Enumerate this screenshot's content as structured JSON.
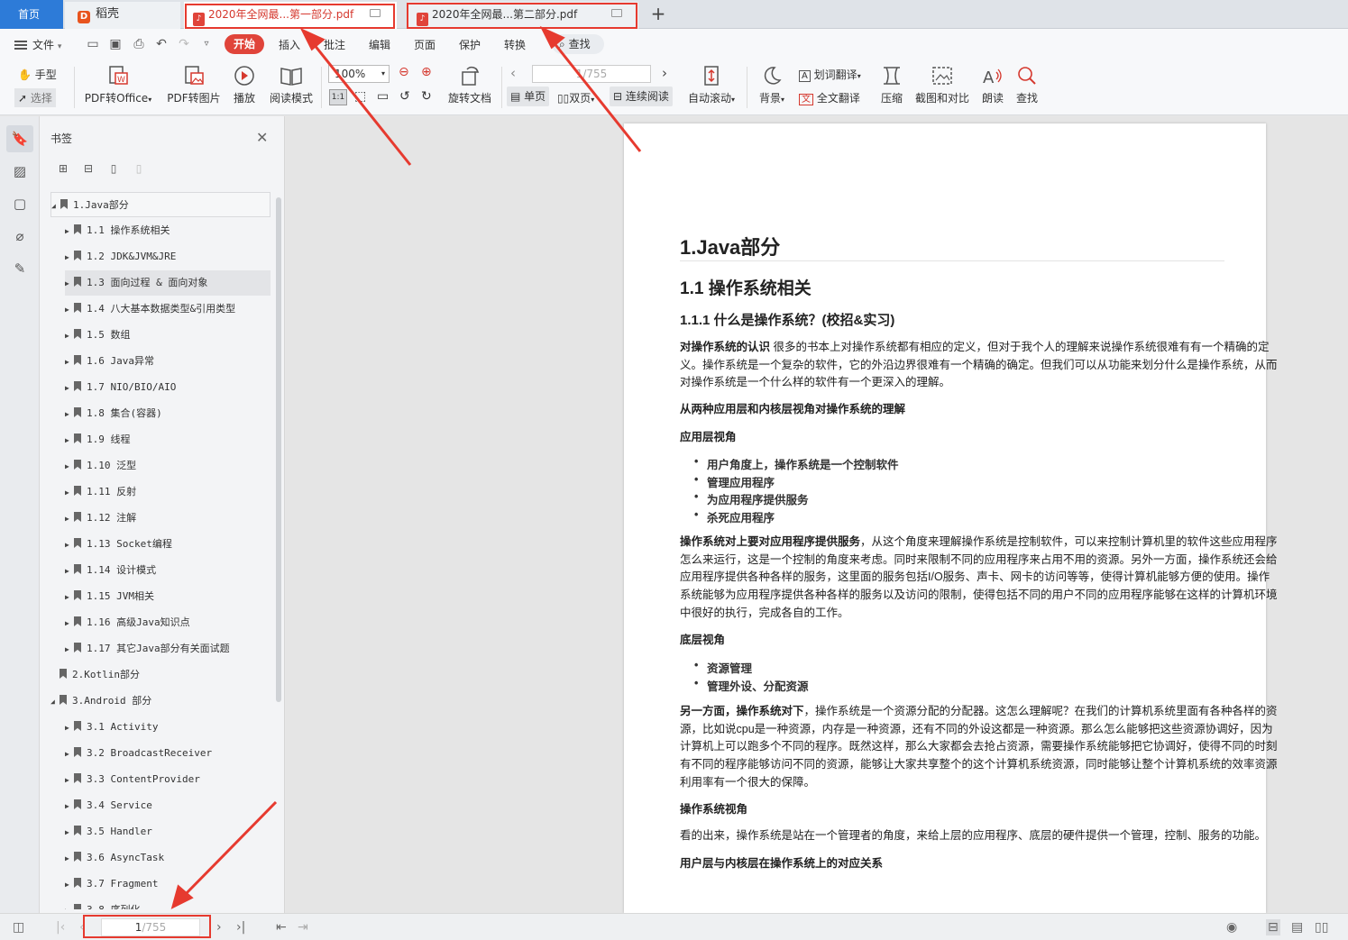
{
  "tabbar": {
    "home": "首页",
    "daoke": "稻壳",
    "doc_tabs": [
      {
        "title": "2020年全网最...第一部分.pdf"
      },
      {
        "title": "2020年全网最...第二部分.pdf"
      }
    ]
  },
  "menubar": {
    "file": "文件",
    "tabs": [
      "开始",
      "插入",
      "批注",
      "编辑",
      "页面",
      "保护",
      "转换"
    ],
    "search": "查找"
  },
  "ribbon": {
    "hand": "手型",
    "select": "选择",
    "pdf_to_office": "PDF转Office",
    "pdf_to_image": "PDF转图片",
    "play": "播放",
    "reading_mode": "阅读模式",
    "zoom": "100%",
    "rotate": "旋转文档",
    "page_input": "1/755",
    "single_page": "单页",
    "double_page": "双页",
    "continuous": "连续阅读",
    "auto_scroll": "自动滚动",
    "background": "背景",
    "word_translate": "划词翻译",
    "full_translate": "全文翻译",
    "compress": "压缩",
    "screenshot_compare": "截图和对比",
    "read_aloud": "朗读",
    "find": "查找"
  },
  "bookmarks": {
    "title": "书签",
    "items": [
      {
        "label": "1.Java部分",
        "level": 0,
        "expanded": true
      },
      {
        "label": "1.1 操作系统相关",
        "level": 1
      },
      {
        "label": "1.2 JDK&JVM&JRE",
        "level": 1
      },
      {
        "label": "1.3 面向过程 & 面向对象",
        "level": 1
      },
      {
        "label": "1.4 八大基本数据类型&引用类型",
        "level": 1
      },
      {
        "label": "1.5 数组",
        "level": 1
      },
      {
        "label": "1.6 Java异常",
        "level": 1
      },
      {
        "label": "1.7 NIO/BIO/AIO",
        "level": 1
      },
      {
        "label": "1.8 集合(容器)",
        "level": 1
      },
      {
        "label": "1.9 线程",
        "level": 1
      },
      {
        "label": "1.10 泛型",
        "level": 1
      },
      {
        "label": "1.11 反射",
        "level": 1
      },
      {
        "label": "1.12 注解",
        "level": 1
      },
      {
        "label": "1.13 Socket编程",
        "level": 1
      },
      {
        "label": "1.14 设计模式",
        "level": 1
      },
      {
        "label": "1.15 JVM相关",
        "level": 1
      },
      {
        "label": "1.16 高级Java知识点",
        "level": 1
      },
      {
        "label": "1.17 其它Java部分有关面试题",
        "level": 1
      },
      {
        "label": "2.Kotlin部分",
        "level": 0,
        "expanded": false
      },
      {
        "label": "3.Android 部分",
        "level": 0,
        "expanded": true
      },
      {
        "label": "3.1 Activity",
        "level": 1
      },
      {
        "label": "3.2 BroadcastReceiver",
        "level": 1
      },
      {
        "label": "3.3 ContentProvider",
        "level": 1
      },
      {
        "label": "3.4 Service",
        "level": 1
      },
      {
        "label": "3.5 Handler",
        "level": 1
      },
      {
        "label": "3.6 AsyncTask",
        "level": 1
      },
      {
        "label": "3.7 Fragment",
        "level": 1
      },
      {
        "label": "3.8 序列化",
        "level": 1
      }
    ]
  },
  "document": {
    "h1": "1.Java部分",
    "h2": "1.1 操作系统相关",
    "h3": "1.1.1 什么是操作系统？(校招&实习)",
    "p1_bold": "对操作系统的认识",
    "p1_text": " 很多的书本上对操作系统都有相应的定义，但对于我个人的理解来说操作系统很难有有一个精确的定义。操作系统是一个复杂的软件，它的外沿边界很难有一个精确的确定。但我们可以从功能来划分什么是操作系统，从而对操作系统是一个什么样的软件有一个更深入的理解。",
    "s1": "从两种应用层和内核层视角对操作系统的理解",
    "s2": "应用层视角",
    "list1": [
      "用户角度上，操作系统是一个控制软件",
      "管理应用程序",
      "为应用程序提供服务",
      "杀死应用程序"
    ],
    "p2_bold": "操作系统对上要对应用程序提供服务",
    "p2_text": "，从这个角度来理解操作系统是控制软件，可以来控制计算机里的软件这些应用程序怎么来运行，这是一个控制的角度来考虑。同时来限制不同的应用程序来占用不用的资源。另外一方面，操作系统还会给应用程序提供各种各样的服务，这里面的服务包括I/O服务、声卡、网卡的访问等等，使得计算机能够方便的使用。操作系统能够为应用程序提供各种各样的服务以及访问的限制，使得包括不同的用户不同的应用程序能够在这样的计算机环境中很好的执行，完成各自的工作。",
    "s3": "底层视角",
    "list2": [
      "资源管理",
      "管理外设、分配资源"
    ],
    "p3_bold": "另一方面，操作系统对下",
    "p3_text": "，操作系统是一个资源分配的分配器。这怎么理解呢？在我们的计算机系统里面有各种各样的资源，比如说cpu是一种资源，内存是一种资源，还有不同的外设这都是一种资源。那么怎么能够把这些资源协调好，因为计算机上可以跑多个不同的程序。既然这样，那么大家都会去抢占资源，需要操作系统能够把它协调好，使得不同的时刻有不同的程序能够访问不同的资源，能够让大家共享整个的这个计算机系统资源，同时能够让整个计算机系统的效率资源利用率有一个很大的保障。",
    "s4": "操作系统视角",
    "p4": "看的出来，操作系统是站在一个管理者的角度，来给上层的应用程序、底层的硬件提供一个管理，控制、服务的功能。",
    "s5": "用户层与内核层在操作系统上的对应关系"
  },
  "statusbar": {
    "current_page": "1",
    "total_pages": "/755"
  },
  "colors": {
    "accent_blue": "#2d7bd8",
    "accent_red": "#e0443a",
    "annotation_red": "#e63a2f"
  }
}
